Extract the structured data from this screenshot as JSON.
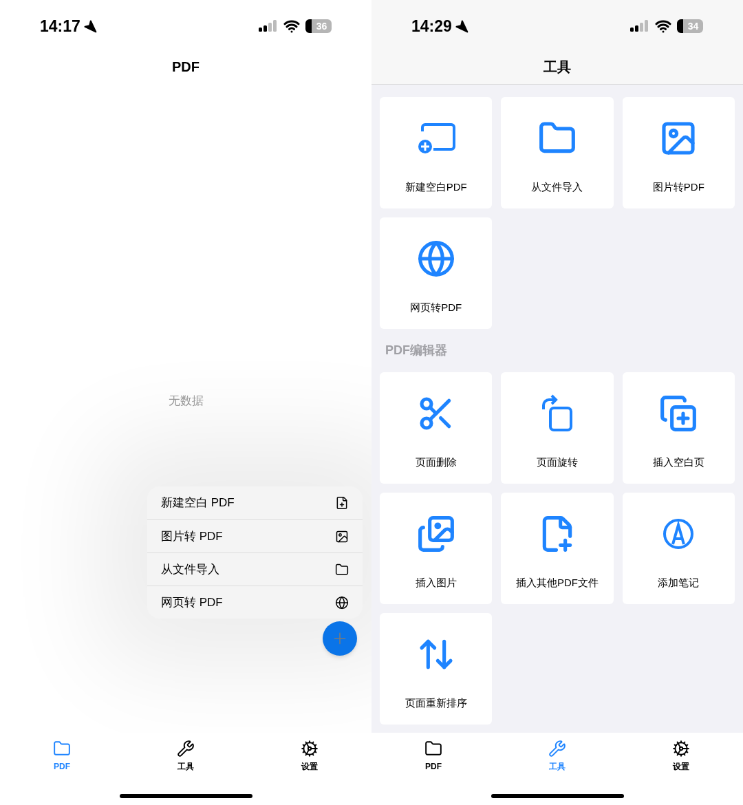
{
  "screens": [
    {
      "status_bar": {
        "time": "14:17",
        "battery": "36"
      },
      "title": "PDF",
      "empty_text": "无数据",
      "menu": [
        {
          "label": "新建空白 PDF"
        },
        {
          "label": "图片转 PDF"
        },
        {
          "label": "从文件导入"
        },
        {
          "label": "网页转 PDF"
        }
      ],
      "tab_bar": [
        {
          "label": "PDF",
          "selected": true
        },
        {
          "label": "工具",
          "selected": false
        },
        {
          "label": "设置",
          "selected": false
        }
      ]
    },
    {
      "status_bar": {
        "time": "14:29",
        "battery": "34"
      },
      "title": "工具",
      "sections": [
        {
          "tools": [
            {
              "label": "新建空白PDF"
            },
            {
              "label": "从文件导入"
            },
            {
              "label": "图片转PDF"
            },
            {
              "label": "网页转PDF"
            }
          ]
        },
        {
          "heading": "PDF编辑器",
          "tools": [
            {
              "label": "页面删除"
            },
            {
              "label": "页面旋转"
            },
            {
              "label": "插入空白页"
            },
            {
              "label": "插入图片"
            },
            {
              "label": "插入其他PDF文件"
            },
            {
              "label": "添加笔记"
            },
            {
              "label": "页面重新排序"
            }
          ]
        }
      ],
      "tab_bar": [
        {
          "label": "PDF",
          "selected": false
        },
        {
          "label": "工具",
          "selected": true
        },
        {
          "label": "设置",
          "selected": false
        }
      ]
    }
  ]
}
